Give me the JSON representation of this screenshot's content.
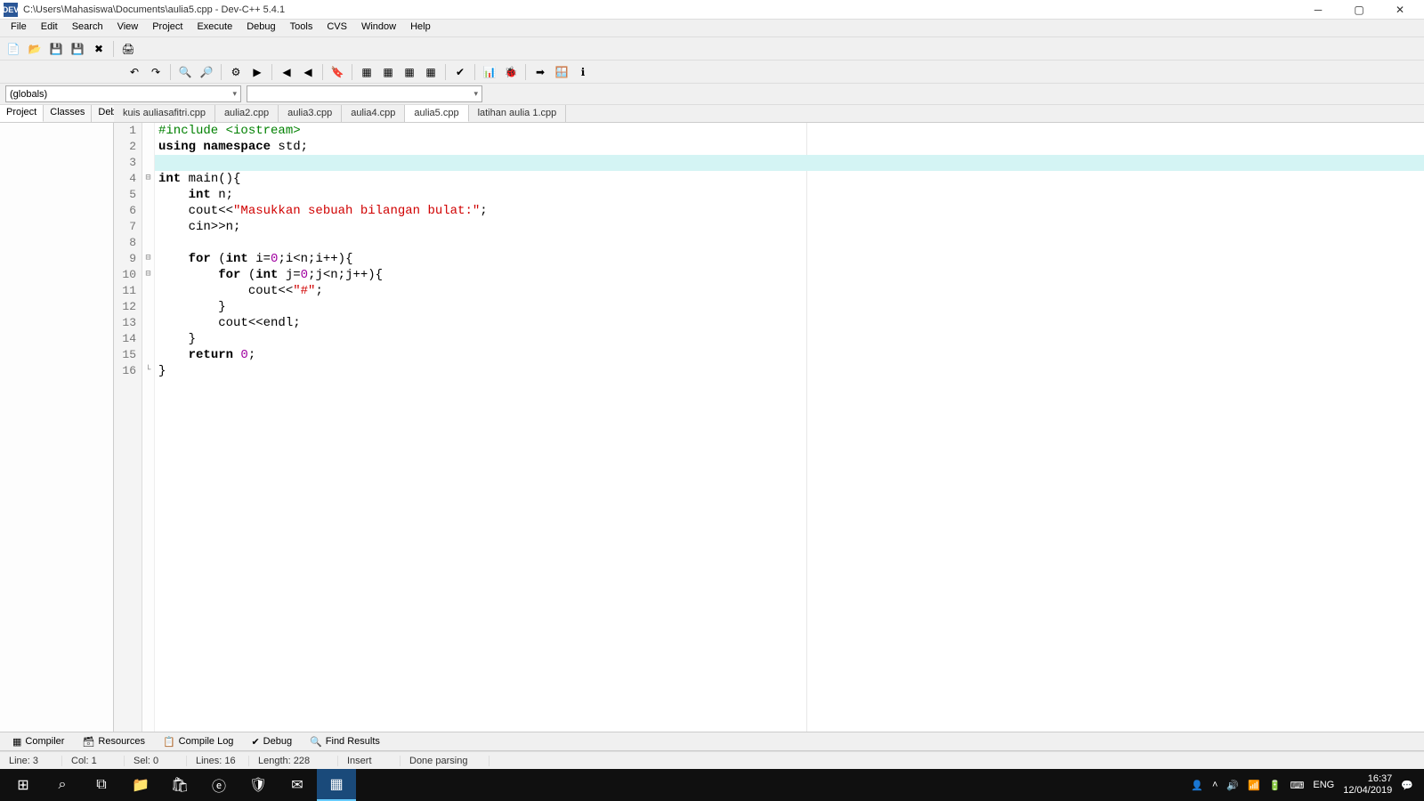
{
  "window": {
    "title": "C:\\Users\\Mahasiswa\\Documents\\aulia5.cpp - Dev-C++ 5.4.1",
    "icon_text": "DEV"
  },
  "menus": [
    "File",
    "Edit",
    "Search",
    "View",
    "Project",
    "Execute",
    "Debug",
    "Tools",
    "CVS",
    "Window",
    "Help"
  ],
  "scope_dropdown": "(globals)",
  "side_tabs": [
    "Project",
    "Classes",
    "Debug"
  ],
  "active_side_tab": 0,
  "file_tabs": [
    "kuis auliasafitri.cpp",
    "aulia2.cpp",
    "aulia3.cpp",
    "aulia4.cpp",
    "aulia5.cpp",
    "latihan aulia 1.cpp"
  ],
  "active_file_tab": 4,
  "code": {
    "lines": [
      {
        "n": 1,
        "fold": "",
        "tokens": [
          {
            "t": "#include ",
            "c": "pp"
          },
          {
            "t": "<iostream>",
            "c": "pp"
          }
        ]
      },
      {
        "n": 2,
        "fold": "",
        "tokens": [
          {
            "t": "using namespace ",
            "c": "kw"
          },
          {
            "t": "std",
            "c": ""
          },
          {
            "t": ";",
            "c": ""
          }
        ]
      },
      {
        "n": 3,
        "fold": "",
        "hl": true,
        "tokens": [
          {
            "t": "",
            "c": ""
          }
        ]
      },
      {
        "n": 4,
        "fold": "⊟",
        "tokens": [
          {
            "t": "int ",
            "c": "kw"
          },
          {
            "t": "main(){",
            "c": ""
          }
        ]
      },
      {
        "n": 5,
        "fold": "",
        "tokens": [
          {
            "t": "    ",
            "c": ""
          },
          {
            "t": "int ",
            "c": "kw"
          },
          {
            "t": "n;",
            "c": ""
          }
        ]
      },
      {
        "n": 6,
        "fold": "",
        "tokens": [
          {
            "t": "    cout<<",
            "c": ""
          },
          {
            "t": "\"Masukkan sebuah bilangan bulat:\"",
            "c": "str"
          },
          {
            "t": ";",
            "c": ""
          }
        ]
      },
      {
        "n": 7,
        "fold": "",
        "tokens": [
          {
            "t": "    cin>>n;",
            "c": ""
          }
        ]
      },
      {
        "n": 8,
        "fold": "",
        "tokens": [
          {
            "t": "",
            "c": ""
          }
        ]
      },
      {
        "n": 9,
        "fold": "⊟",
        "tokens": [
          {
            "t": "    ",
            "c": ""
          },
          {
            "t": "for ",
            "c": "kw"
          },
          {
            "t": "(",
            "c": ""
          },
          {
            "t": "int ",
            "c": "kw"
          },
          {
            "t": "i=",
            "c": ""
          },
          {
            "t": "0",
            "c": "num"
          },
          {
            "t": ";i<n;i++){",
            "c": ""
          }
        ]
      },
      {
        "n": 10,
        "fold": "⊟",
        "tokens": [
          {
            "t": "        ",
            "c": ""
          },
          {
            "t": "for ",
            "c": "kw"
          },
          {
            "t": "(",
            "c": ""
          },
          {
            "t": "int ",
            "c": "kw"
          },
          {
            "t": "j=",
            "c": ""
          },
          {
            "t": "0",
            "c": "num"
          },
          {
            "t": ";j<n;j++){",
            "c": ""
          }
        ]
      },
      {
        "n": 11,
        "fold": "",
        "tokens": [
          {
            "t": "            cout<<",
            "c": ""
          },
          {
            "t": "\"#\"",
            "c": "str"
          },
          {
            "t": ";",
            "c": ""
          }
        ]
      },
      {
        "n": 12,
        "fold": "",
        "tokens": [
          {
            "t": "        }",
            "c": ""
          }
        ]
      },
      {
        "n": 13,
        "fold": "",
        "tokens": [
          {
            "t": "        cout<<endl;",
            "c": ""
          }
        ]
      },
      {
        "n": 14,
        "fold": "",
        "tokens": [
          {
            "t": "    }",
            "c": ""
          }
        ]
      },
      {
        "n": 15,
        "fold": "",
        "tokens": [
          {
            "t": "    ",
            "c": ""
          },
          {
            "t": "return ",
            "c": "kw"
          },
          {
            "t": "0",
            "c": "num"
          },
          {
            "t": ";",
            "c": ""
          }
        ]
      },
      {
        "n": 16,
        "fold": "└",
        "tokens": [
          {
            "t": "}",
            "c": ""
          }
        ]
      }
    ]
  },
  "bottom_tabs": [
    {
      "icon": "▦",
      "label": "Compiler"
    },
    {
      "icon": "🗃",
      "label": "Resources"
    },
    {
      "icon": "📋",
      "label": "Compile Log"
    },
    {
      "icon": "✔",
      "label": "Debug"
    },
    {
      "icon": "🔍",
      "label": "Find Results"
    }
  ],
  "status": {
    "line_label": "Line:",
    "line": "3",
    "col_label": "Col:",
    "col": "1",
    "sel_label": "Sel:",
    "sel": "0",
    "lines_label": "Lines:",
    "lines": "16",
    "length_label": "Length:",
    "length": "228",
    "insert": "Insert",
    "done": "Done parsing"
  },
  "taskbar": {
    "lang": "ENG",
    "time": "16:37",
    "date": "12/04/2019"
  }
}
